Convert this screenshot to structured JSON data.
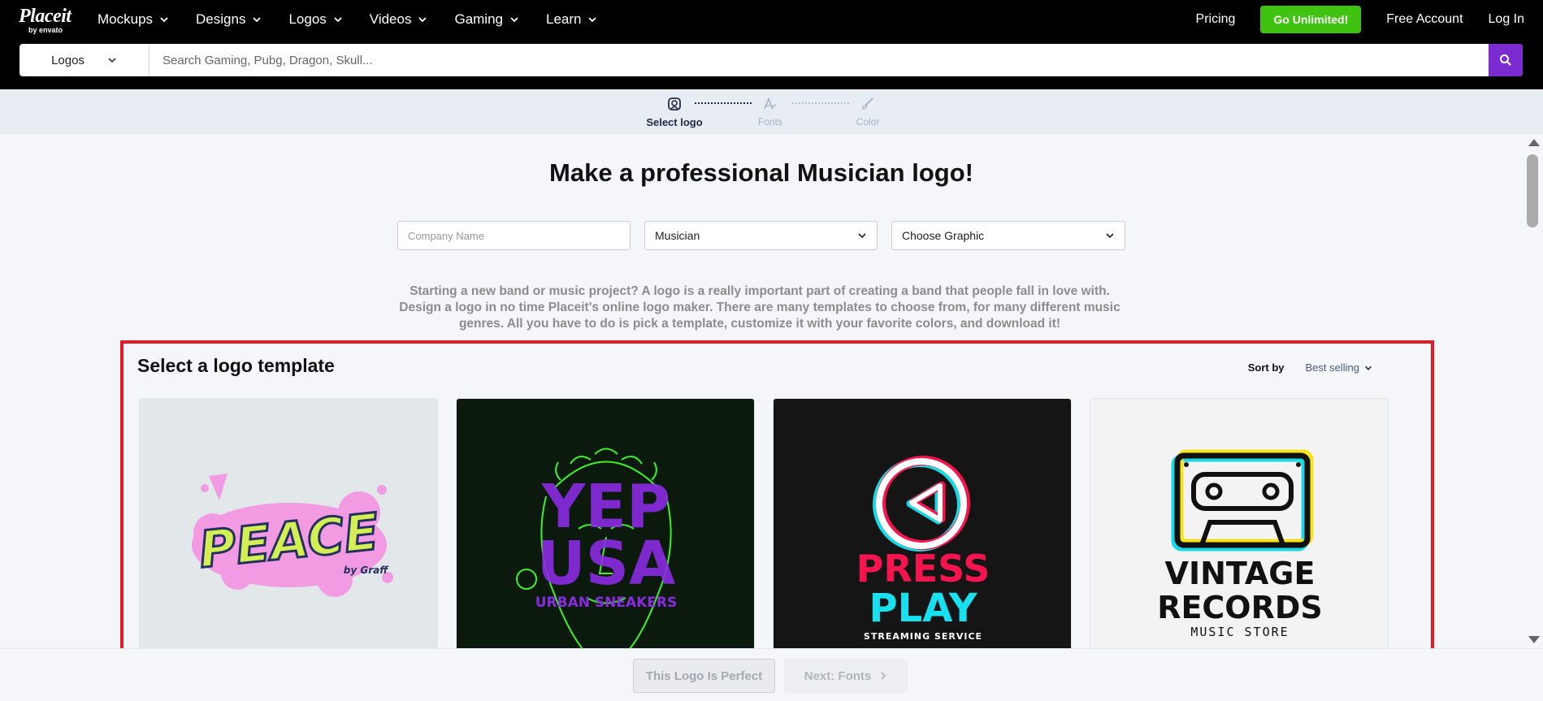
{
  "brand": {
    "name": "Placeit",
    "sub": "by envato"
  },
  "nav": [
    {
      "label": "Mockups"
    },
    {
      "label": "Designs"
    },
    {
      "label": "Logos"
    },
    {
      "label": "Videos"
    },
    {
      "label": "Gaming"
    },
    {
      "label": "Learn"
    }
  ],
  "right_nav": {
    "pricing": "Pricing",
    "go_unlimited": "Go Unlimited!",
    "free_account": "Free Account",
    "login": "Log In"
  },
  "search": {
    "category": "Logos",
    "placeholder": "Search Gaming, Pubg, Dragon, Skull..."
  },
  "steps": [
    {
      "label": "Select logo",
      "active": true
    },
    {
      "label": "Fonts",
      "active": false
    },
    {
      "label": "Color",
      "active": false
    }
  ],
  "main": {
    "headline": "Make a professional Musician logo!",
    "company_placeholder": "Company Name",
    "industry_value": "Musician",
    "graphic_value": "Choose Graphic",
    "description": "Starting a new band or music project? A logo is a really important part of creating a band that people fall in love with. Design a logo in no time Placeit's online logo maker. There are many templates to choose from, for many different music genres. All you have to do is pick a template, customize it with your favorite colors, and download it!"
  },
  "templates": {
    "title": "Select a logo template",
    "sort_label": "Sort by",
    "sort_value": "Best selling",
    "cards": [
      {
        "line1": "PEACE",
        "line2": "by Graff",
        "bg": "#e2e7ea"
      },
      {
        "line1": "YEP",
        "line2": "USA",
        "line3": "URBAN SNEAKERS",
        "bg": "#0b1a0d"
      },
      {
        "line1": "PRESS",
        "line2": "PLAY",
        "line3": "STREAMING SERVICE",
        "bg": "#151515"
      },
      {
        "line1": "VINTAGE",
        "line2": "RECORDS",
        "line3": "MUSIC STORE",
        "bg": "#f3f3f3"
      }
    ]
  },
  "bottom": {
    "perfect": "This Logo Is Perfect",
    "next": "Next: Fonts"
  },
  "colors": {
    "accent_purple": "#7b2cd0",
    "go_green": "#3fc210",
    "highlight_red": "#e11d23"
  }
}
